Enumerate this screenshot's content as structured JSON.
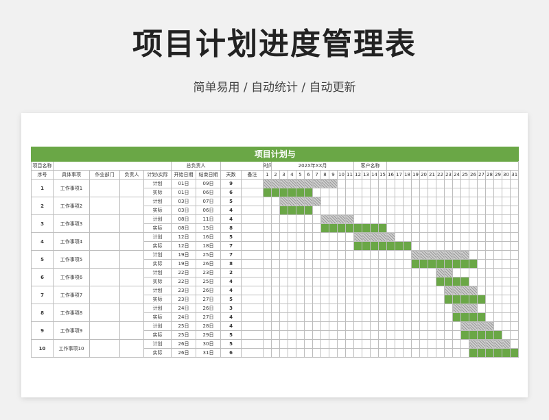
{
  "header": {
    "title": "项目计划进度管理表",
    "subtitle": "简单易用 / 自动统计 / 自动更新"
  },
  "sheet": {
    "banner": "项目计划与",
    "info_row": {
      "project_name_label": "项目名称",
      "owner_label": "总负责人",
      "time_label": "时间",
      "time_value": "202X年XX月",
      "client_label": "客户名称"
    },
    "columns": {
      "seq": "序号",
      "item": "具体事项",
      "dept": "作业部门",
      "person": "负责人",
      "type": "计划\\实际",
      "start": "开始日期",
      "end": "结束日期",
      "days": "天数",
      "note": "备注"
    },
    "days": [
      "1",
      "2",
      "3",
      "4",
      "5",
      "6",
      "7",
      "8",
      "9",
      "10",
      "11",
      "12",
      "13",
      "14",
      "15",
      "16",
      "17",
      "18",
      "19",
      "20",
      "21",
      "22",
      "23",
      "24",
      "25",
      "26",
      "27",
      "28",
      "29",
      "30",
      "31"
    ],
    "plan_label": "计划",
    "actual_label": "实际",
    "colors": {
      "accent": "#6aa746",
      "plan_hatch": "#9a9a9a"
    },
    "tasks": [
      {
        "no": "1",
        "name": "工作事项1",
        "plan": {
          "start": "01日",
          "end": "09日",
          "days": "9",
          "s": 1,
          "e": 9
        },
        "actual": {
          "start": "01日",
          "end": "06日",
          "days": "6",
          "s": 1,
          "e": 6
        }
      },
      {
        "no": "2",
        "name": "工作事项2",
        "plan": {
          "start": "03日",
          "end": "07日",
          "days": "5",
          "s": 3,
          "e": 7
        },
        "actual": {
          "start": "03日",
          "end": "06日",
          "days": "4",
          "s": 3,
          "e": 6
        }
      },
      {
        "no": "3",
        "name": "工作事项3",
        "plan": {
          "start": "08日",
          "end": "11日",
          "days": "4",
          "s": 8,
          "e": 11
        },
        "actual": {
          "start": "08日",
          "end": "15日",
          "days": "8",
          "s": 8,
          "e": 15
        }
      },
      {
        "no": "4",
        "name": "工作事项4",
        "plan": {
          "start": "12日",
          "end": "16日",
          "days": "5",
          "s": 12,
          "e": 16
        },
        "actual": {
          "start": "12日",
          "end": "18日",
          "days": "7",
          "s": 12,
          "e": 18
        }
      },
      {
        "no": "5",
        "name": "工作事项5",
        "plan": {
          "start": "19日",
          "end": "25日",
          "days": "7",
          "s": 19,
          "e": 25
        },
        "actual": {
          "start": "19日",
          "end": "26日",
          "days": "8",
          "s": 19,
          "e": 26
        }
      },
      {
        "no": "6",
        "name": "工作事项6",
        "plan": {
          "start": "22日",
          "end": "23日",
          "days": "2",
          "s": 22,
          "e": 23
        },
        "actual": {
          "start": "22日",
          "end": "25日",
          "days": "4",
          "s": 22,
          "e": 25
        }
      },
      {
        "no": "7",
        "name": "工作事项7",
        "plan": {
          "start": "23日",
          "end": "26日",
          "days": "4",
          "s": 23,
          "e": 26
        },
        "actual": {
          "start": "23日",
          "end": "27日",
          "days": "5",
          "s": 23,
          "e": 27
        }
      },
      {
        "no": "8",
        "name": "工作事项8",
        "plan": {
          "start": "24日",
          "end": "26日",
          "days": "3",
          "s": 24,
          "e": 26
        },
        "actual": {
          "start": "24日",
          "end": "27日",
          "days": "4",
          "s": 24,
          "e": 27
        }
      },
      {
        "no": "9",
        "name": "工作事项9",
        "plan": {
          "start": "25日",
          "end": "28日",
          "days": "4",
          "s": 25,
          "e": 28
        },
        "actual": {
          "start": "25日",
          "end": "29日",
          "days": "5",
          "s": 25,
          "e": 29
        }
      },
      {
        "no": "10",
        "name": "工作事项10",
        "plan": {
          "start": "26日",
          "end": "30日",
          "days": "5",
          "s": 26,
          "e": 30
        },
        "actual": {
          "start": "26日",
          "end": "31日",
          "days": "6",
          "s": 26,
          "e": 31
        }
      }
    ]
  }
}
